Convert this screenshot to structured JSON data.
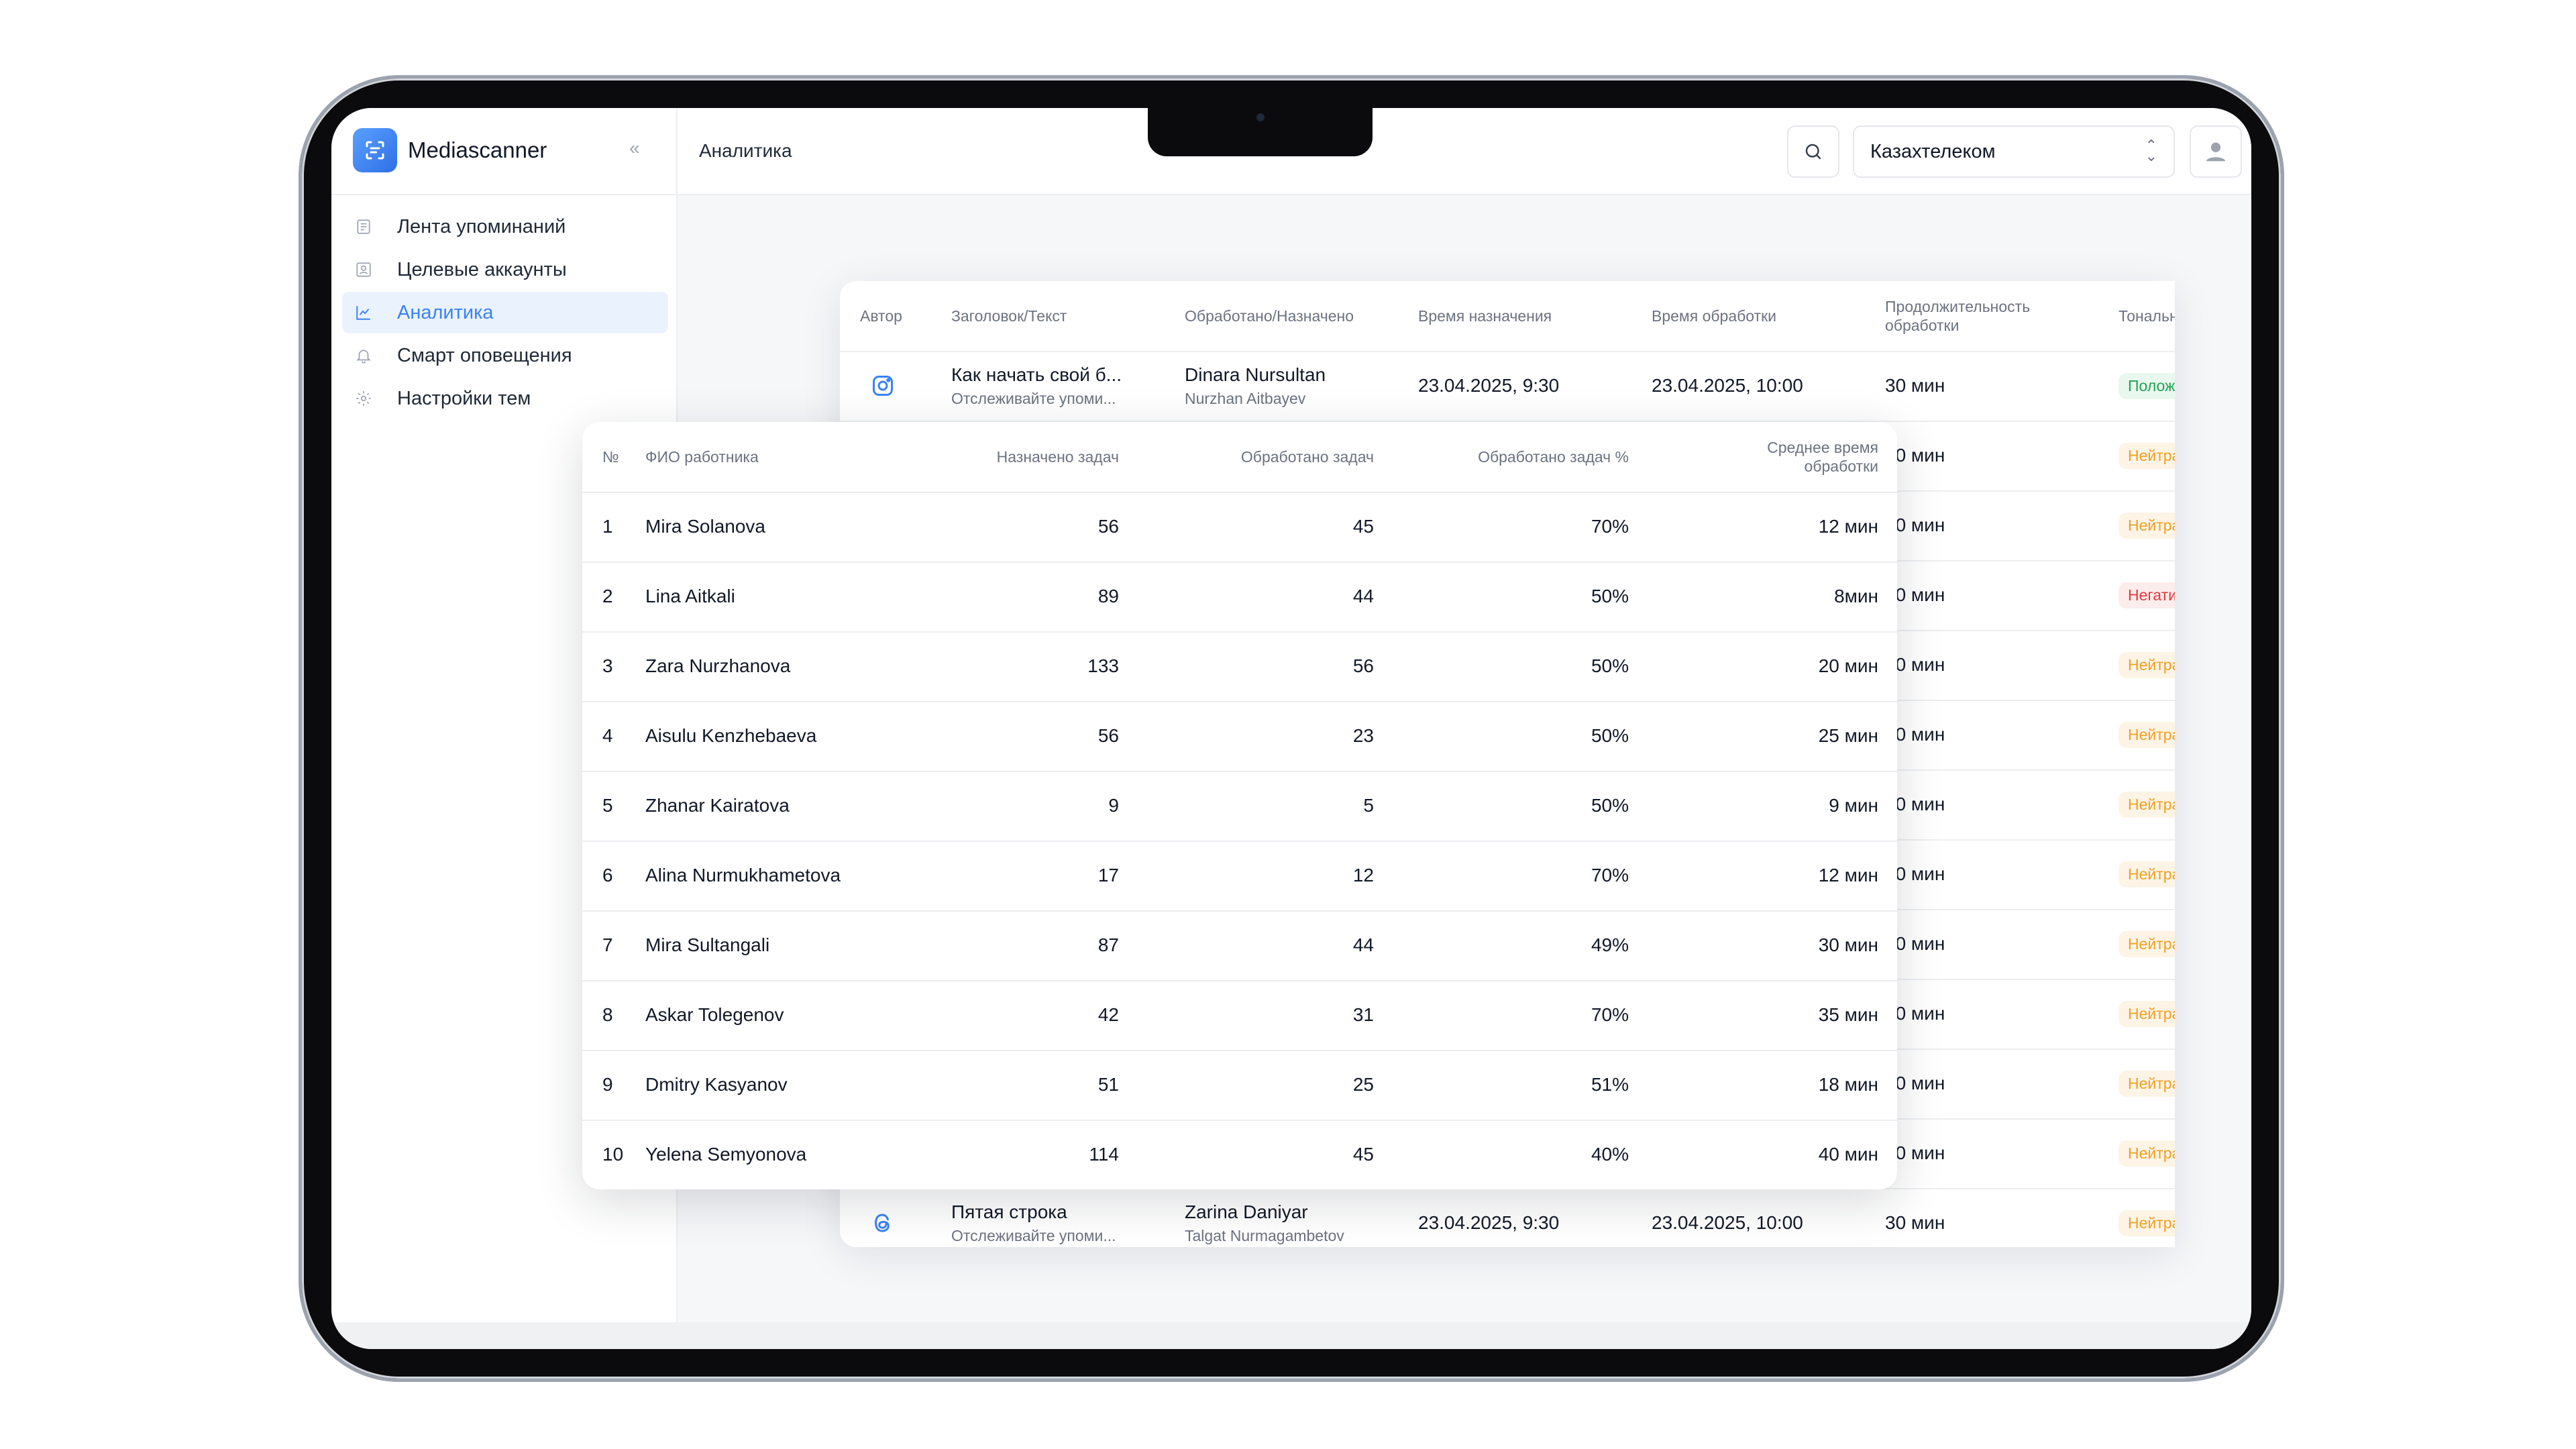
{
  "app": {
    "name": "Mediascanner",
    "collapse_label": "«"
  },
  "sidebar": {
    "items": [
      {
        "label": "Лента упоминаний",
        "icon": "feed-icon",
        "active": false
      },
      {
        "label": "Целевые аккаунты",
        "icon": "accounts-icon",
        "active": false
      },
      {
        "label": "Аналитика",
        "icon": "analytics-icon",
        "active": true
      },
      {
        "label": "Смарт оповещения",
        "icon": "bell-icon",
        "active": false
      },
      {
        "label": "Настройки тем",
        "icon": "gear-icon",
        "active": false
      }
    ]
  },
  "header": {
    "title": "Аналитика",
    "org_select": "Казахтелеком",
    "search_icon": "search-icon",
    "avatar_icon": "user-icon"
  },
  "colors": {
    "accent": "#3b82f6",
    "neutral": "#f0a020",
    "positive": "#22a352",
    "negative": "#e23b3b"
  },
  "mentions_table": {
    "headers": {
      "author": "Автор",
      "title": "Заголовок/Текст",
      "assigned": "Обработано/Назначено",
      "time_assigned": "Время назначения",
      "time_processed": "Время обработки",
      "duration": "Продолжительность обработки",
      "tone": "Тональность"
    },
    "first_row": {
      "author_icon": "instagram-icon",
      "title": "Как начать свой б...",
      "text": "Отслеживайте упоми...",
      "processed_by": "Dinara Nursultan",
      "assigned_to": "Nurzhan Aitbayev",
      "time_assigned": "23.04.2025, 9:30",
      "time_processed": "23.04.2025, 10:00",
      "duration": "30 мин",
      "tone": "Положительный"
    },
    "middle_rows": [
      {
        "duration": "30 мин",
        "tone": "Нейтральный",
        "tone_type": "neutral"
      },
      {
        "duration": "30 мин",
        "tone": "Нейтральный",
        "tone_type": "neutral"
      },
      {
        "duration": "30 мин",
        "tone": "Негативный",
        "tone_type": "negative"
      },
      {
        "duration": "30 мин",
        "tone": "Нейтральный",
        "tone_type": "neutral"
      },
      {
        "duration": "30 мин",
        "tone": "Нейтральный",
        "tone_type": "neutral"
      },
      {
        "duration": "30 мин",
        "tone": "Нейтральный",
        "tone_type": "neutral"
      },
      {
        "duration": "30 мин",
        "tone": "Нейтральный",
        "tone_type": "neutral"
      },
      {
        "duration": "30 мин",
        "tone": "Нейтральный",
        "tone_type": "neutral"
      },
      {
        "duration": "30 мин",
        "tone": "Нейтральный",
        "tone_type": "neutral"
      },
      {
        "duration": "30 мин",
        "tone": "Нейтральный",
        "tone_type": "neutral"
      },
      {
        "duration": "30 мин",
        "tone": "Нейтральный",
        "tone_type": "neutral"
      }
    ],
    "last_row": {
      "author_icon": "threads-icon",
      "title": "Пятая строка",
      "text": "Отслеживайте упоми...",
      "processed_by": "Zarina Daniyar",
      "assigned_to": "Talgat Nurmagambetov",
      "time_assigned": "23.04.2025, 9:30",
      "time_processed": "23.04.2025, 10:00",
      "duration": "30 мин",
      "tone": "Нейтральный"
    }
  },
  "employees_table": {
    "headers": {
      "num": "№",
      "name": "ФИО работника",
      "assigned": "Назначено задач",
      "processed": "Обработано задач",
      "processed_pct": "Обработано задач %",
      "avg_time": "Среднее время обработки"
    },
    "rows": [
      {
        "num": "1",
        "name": "Mira Solanova",
        "assigned": "56",
        "processed": "45",
        "pct": "70%",
        "avg": "12 мин"
      },
      {
        "num": "2",
        "name": "Lina Aitkali",
        "assigned": "89",
        "processed": "44",
        "pct": "50%",
        "avg": "8мин"
      },
      {
        "num": "3",
        "name": "Zara Nurzhanova",
        "assigned": "133",
        "processed": "56",
        "pct": "50%",
        "avg": "20 мин"
      },
      {
        "num": "4",
        "name": "Aisulu Kenzhebaeva",
        "assigned": "56",
        "processed": "23",
        "pct": "50%",
        "avg": "25 мин"
      },
      {
        "num": "5",
        "name": "Zhanar Kairatova",
        "assigned": "9",
        "processed": "5",
        "pct": "50%",
        "avg": "9 мин"
      },
      {
        "num": "6",
        "name": "Alina Nurmukhametova",
        "assigned": "17",
        "processed": "12",
        "pct": "70%",
        "avg": "12 мин"
      },
      {
        "num": "7",
        "name": "Mira Sultangali",
        "assigned": "87",
        "processed": "44",
        "pct": "49%",
        "avg": "30 мин"
      },
      {
        "num": "8",
        "name": "Askar Tolegenov",
        "assigned": "42",
        "processed": "31",
        "pct": "70%",
        "avg": "35 мин"
      },
      {
        "num": "9",
        "name": "Dmitry Kasyanov",
        "assigned": "51",
        "processed": "25",
        "pct": "51%",
        "avg": "18 мин"
      },
      {
        "num": "10",
        "name": "Yelena Semyonova",
        "assigned": "114",
        "processed": "45",
        "pct": "40%",
        "avg": "40 мин"
      }
    ]
  }
}
